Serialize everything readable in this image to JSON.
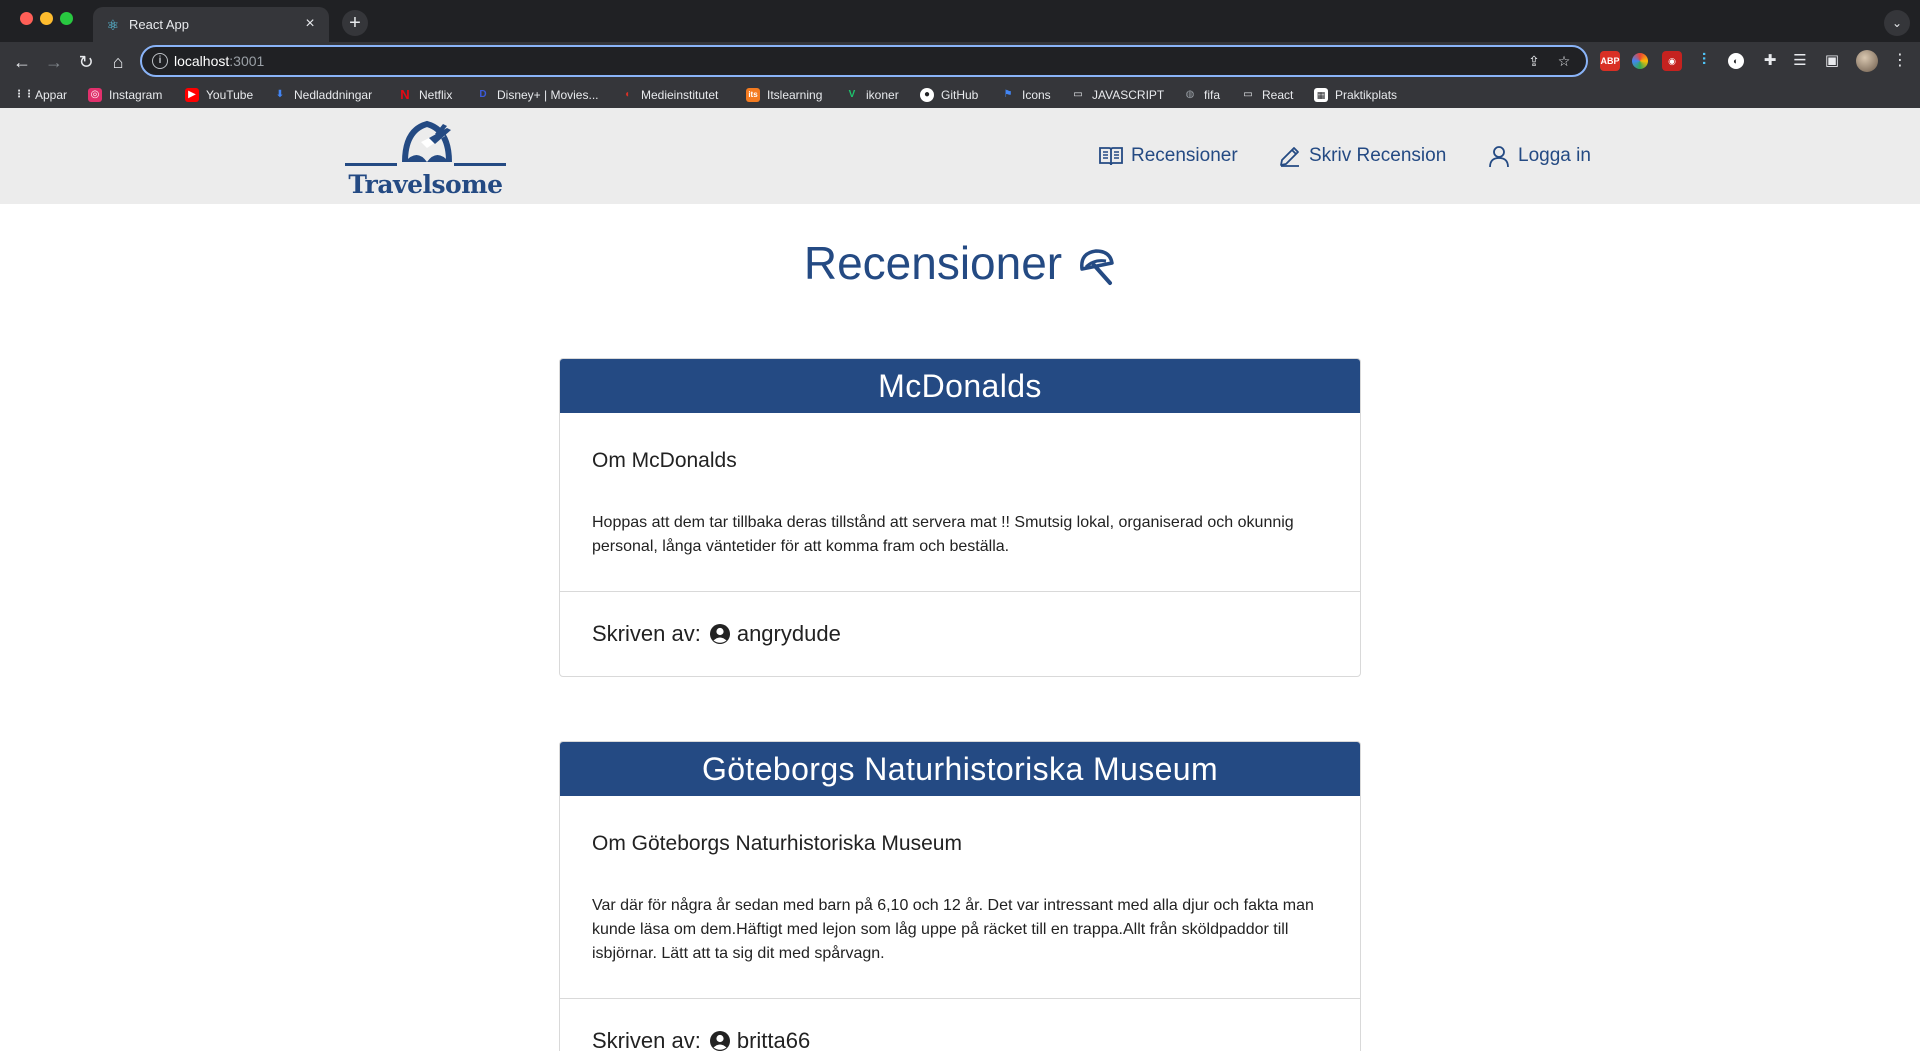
{
  "browser": {
    "tab_title": "React App",
    "url_host": "localhost",
    "url_port": ":3001",
    "bookmarks": [
      {
        "label": "Appar",
        "icon": "apps-grid-icon",
        "color": "#e8eaed"
      },
      {
        "label": "Instagram",
        "icon": "instagram-icon",
        "color": "#e1306c"
      },
      {
        "label": "YouTube",
        "icon": "youtube-icon",
        "color": "#ff0000"
      },
      {
        "label": "Nedladdningar",
        "icon": "download-icon",
        "color": "#4285f4"
      },
      {
        "label": "Netflix",
        "icon": "netflix-icon",
        "color": "#e50914"
      },
      {
        "label": "Disney+ | Movies...",
        "icon": "disney-icon",
        "color": "#3b5bdb"
      },
      {
        "label": "Medieinstitutet",
        "icon": "medieinstitutet-icon",
        "color": "#d93025"
      },
      {
        "label": "Itslearning",
        "icon": "itslearning-icon",
        "color": "#f47b20"
      },
      {
        "label": "ikoner",
        "icon": "vuetify-icon",
        "color": "#1dc46d"
      },
      {
        "label": "GitHub",
        "icon": "github-icon",
        "color": "#ffffff"
      },
      {
        "label": "Icons",
        "icon": "flag-icon",
        "color": "#4285f4"
      },
      {
        "label": "JAVASCRIPT",
        "icon": "folder-icon",
        "color": "#e8eaed"
      },
      {
        "label": "fifa",
        "icon": "globe-icon",
        "color": "#9aa0a6"
      },
      {
        "label": "React",
        "icon": "folder-icon",
        "color": "#e8eaed"
      },
      {
        "label": "Praktikplats",
        "icon": "praktikplats-icon",
        "color": "#ffffff"
      }
    ]
  },
  "site": {
    "logo_text": "Travelsome",
    "nav": {
      "reviews": "Recensioner",
      "write_review": "Skriv Recension",
      "login": "Logga in"
    },
    "page_title": "Recensioner"
  },
  "reviews": [
    {
      "title": "McDonalds",
      "subtitle": "Om McDonalds",
      "text": "Hoppas att dem tar tillbaka deras tillstånd att servera mat !! Smutsig lokal, organiserad och okunnig personal, långa väntetider för att komma fram och beställa.",
      "author_label": "Skriven av:",
      "author": "angrydude"
    },
    {
      "title": "Göteborgs Naturhistoriska Museum",
      "subtitle": "Om Göteborgs Naturhistoriska Museum",
      "text": "Var där för några år sedan med barn på 6,10 och 12 år. Det var intressant med alla djur och fakta man kunde läsa om dem.Häftigt med lejon som låg uppe på räcket till en trappa.Allt från sköldpaddor till isbjörnar. Lätt att ta sig dit med spårvagn.",
      "author_label": "Skriven av:",
      "author": "britta66"
    }
  ],
  "colors": {
    "brand": "#244a83",
    "header_bg": "#ececec"
  }
}
